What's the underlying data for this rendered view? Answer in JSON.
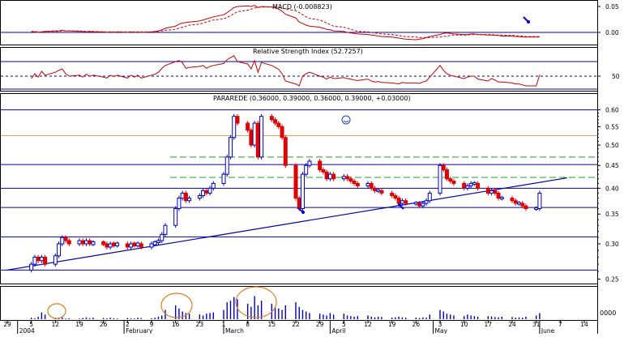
{
  "colors": {
    "background": "#ffffff",
    "panel_border": "#000000",
    "hline_blue": "#0000b0",
    "hline_orange": "#e0a060",
    "hline_green": "#20a020",
    "trend": "#0000b0",
    "candle_up": "#0000c8",
    "candle_down": "#e00000",
    "indicator": "#cc0000",
    "volume": "#0000c8",
    "annotation_circle": "#e08020",
    "arrow": "#0000cc"
  },
  "panels": {
    "macd_title": "MACD (-0.008823)",
    "rsi_title": "Relative Strength Index (52.7257)",
    "price_title": "PARAREDE (0.36000, 0.39000, 0.36000, 0.39000, +0.03000)",
    "volume_unit": "0000"
  },
  "axis_labels": {
    "macd_ticks": [
      "0.05",
      "0.00"
    ],
    "rsi_ticks": [
      "50"
    ],
    "price_ticks": [
      "0.60",
      "0.55",
      "0.50",
      "0.45",
      "0.40",
      "0.35",
      "0.30",
      "0.25"
    ],
    "x_days": [
      "29",
      "5",
      "12",
      "19",
      "26",
      "2",
      "9",
      "16",
      "23",
      "1",
      "8",
      "15",
      "22",
      "29",
      "5",
      "12",
      "19",
      "26",
      "3",
      "10",
      "17",
      "24",
      "31",
      "7",
      "14"
    ],
    "x_months": [
      "2004",
      "February",
      "March",
      "April",
      "May",
      "June"
    ]
  },
  "chart_data": [
    {
      "type": "candlestick",
      "title": "PARAREDE (0.36000, 0.39000, 0.36000, 0.39000, +0.03000)",
      "x_start": "2003-12-29",
      "x_end": "2004-06-14",
      "ylim": [
        0.24,
        0.62
      ],
      "yscale": "log",
      "yticks": [
        0.6,
        0.55,
        0.5,
        0.45,
        0.4,
        0.35,
        0.3,
        0.25
      ],
      "grid": false,
      "horizontal_lines": [
        {
          "value": 0.6,
          "color": "blue",
          "style": "solid"
        },
        {
          "value": 0.525,
          "color": "orange",
          "style": "solid"
        },
        {
          "value": 0.47,
          "color": "green",
          "style": "dashed"
        },
        {
          "value": 0.452,
          "color": "blue",
          "style": "solid"
        },
        {
          "value": 0.423,
          "color": "green",
          "style": "dashed"
        },
        {
          "value": 0.4,
          "color": "blue",
          "style": "solid"
        },
        {
          "value": 0.362,
          "color": "blue",
          "style": "solid"
        },
        {
          "value": 0.311,
          "color": "blue",
          "style": "solid"
        },
        {
          "value": 0.262,
          "color": "blue",
          "style": "solid"
        }
      ],
      "trendline": {
        "from": [
          "2003-12-29",
          0.262
        ],
        "to": [
          "2004-06-09",
          0.422
        ]
      },
      "dates": [
        "2004-01-05",
        "2004-01-06",
        "2004-01-07",
        "2004-01-08",
        "2004-01-09",
        "2004-01-12",
        "2004-01-13",
        "2004-01-14",
        "2004-01-15",
        "2004-01-16",
        "2004-01-19",
        "2004-01-20",
        "2004-01-21",
        "2004-01-22",
        "2004-01-23",
        "2004-01-26",
        "2004-01-27",
        "2004-01-28",
        "2004-01-29",
        "2004-01-30",
        "2004-02-02",
        "2004-02-03",
        "2004-02-04",
        "2004-02-05",
        "2004-02-06",
        "2004-02-09",
        "2004-02-10",
        "2004-02-11",
        "2004-02-12",
        "2004-02-13",
        "2004-02-16",
        "2004-02-17",
        "2004-02-18",
        "2004-02-19",
        "2004-02-20",
        "2004-02-23",
        "2004-02-24",
        "2004-02-25",
        "2004-02-26",
        "2004-02-27",
        "2004-03-01",
        "2004-03-02",
        "2004-03-03",
        "2004-03-04",
        "2004-03-05",
        "2004-03-08",
        "2004-03-09",
        "2004-03-10",
        "2004-03-11",
        "2004-03-12",
        "2004-03-15",
        "2004-03-16",
        "2004-03-17",
        "2004-03-18",
        "2004-03-19",
        "2004-03-22",
        "2004-03-23",
        "2004-03-24",
        "2004-03-25",
        "2004-03-26",
        "2004-03-29",
        "2004-03-30",
        "2004-03-31",
        "2004-04-01",
        "2004-04-02",
        "2004-04-05",
        "2004-04-06",
        "2004-04-07",
        "2004-04-08",
        "2004-04-09",
        "2004-04-12",
        "2004-04-13",
        "2004-04-14",
        "2004-04-15",
        "2004-04-16",
        "2004-04-19",
        "2004-04-20",
        "2004-04-21",
        "2004-04-22",
        "2004-04-23",
        "2004-04-26",
        "2004-04-27",
        "2004-04-28",
        "2004-04-29",
        "2004-04-30",
        "2004-05-03",
        "2004-05-04",
        "2004-05-05",
        "2004-05-06",
        "2004-05-07",
        "2004-05-10",
        "2004-05-11",
        "2004-05-12",
        "2004-05-13",
        "2004-05-14",
        "2004-05-17",
        "2004-05-18",
        "2004-05-19",
        "2004-05-20",
        "2004-05-21",
        "2004-05-24",
        "2004-05-25",
        "2004-05-26",
        "2004-05-27",
        "2004-05-28",
        "2004-05-31",
        "2004-06-01"
      ],
      "close": [
        0.27,
        0.28,
        0.275,
        0.28,
        0.27,
        0.282,
        0.3,
        0.31,
        0.305,
        0.3,
        0.305,
        0.3,
        0.305,
        0.3,
        0.302,
        0.3,
        0.295,
        0.3,
        0.298,
        0.3,
        0.295,
        0.3,
        0.298,
        0.3,
        0.295,
        0.3,
        0.302,
        0.305,
        0.315,
        0.33,
        0.36,
        0.38,
        0.39,
        0.375,
        0.38,
        0.385,
        0.395,
        0.39,
        0.4,
        0.41,
        0.43,
        0.47,
        0.52,
        0.58,
        0.56,
        0.54,
        0.5,
        0.56,
        0.47,
        0.58,
        0.57,
        0.56,
        0.55,
        0.52,
        0.45,
        0.38,
        0.36,
        0.43,
        0.45,
        0.46,
        0.44,
        0.435,
        0.42,
        0.43,
        0.42,
        0.425,
        0.42,
        0.415,
        0.41,
        0.405,
        0.41,
        0.4,
        0.395,
        0.395,
        0.39,
        0.385,
        0.38,
        0.37,
        0.375,
        0.37,
        0.37,
        0.365,
        0.37,
        0.375,
        0.39,
        0.45,
        0.44,
        0.42,
        0.415,
        0.41,
        0.4,
        0.405,
        0.41,
        0.41,
        0.4,
        0.39,
        0.395,
        0.39,
        0.38,
        0.38,
        0.375,
        0.37,
        0.37,
        0.365,
        0.36,
        0.36,
        0.39
      ],
      "volume_percent_of_axis": [
        5,
        3,
        8,
        22,
        15,
        4,
        3,
        6,
        2,
        3,
        2,
        4,
        6,
        3,
        5,
        4,
        3,
        5,
        3,
        2,
        4,
        3,
        2,
        5,
        4,
        3,
        5,
        8,
        12,
        30,
        45,
        35,
        25,
        20,
        18,
        15,
        12,
        18,
        20,
        22,
        30,
        55,
        60,
        72,
        65,
        50,
        40,
        75,
        45,
        60,
        50,
        40,
        35,
        30,
        45,
        55,
        40,
        30,
        25,
        20,
        18,
        15,
        12,
        20,
        15,
        18,
        12,
        10,
        8,
        10,
        12,
        8,
        6,
        8,
        7,
        5,
        6,
        8,
        6,
        5,
        5,
        4,
        6,
        5,
        15,
        30,
        25,
        18,
        15,
        12,
        10,
        15,
        12,
        10,
        8,
        10,
        9,
        7,
        6,
        8,
        7,
        5,
        6,
        5,
        8,
        12,
        20
      ]
    },
    {
      "type": "line",
      "title": "MACD (-0.008823)",
      "ylim": [
        -0.02,
        0.065
      ],
      "yticks": [
        0.05,
        0.0
      ],
      "series": [
        {
          "name": "MACD",
          "style": "solid",
          "values": [
            0.001,
            0.001,
            0.0,
            0.001,
            0.002,
            0.003,
            0.003,
            0.004,
            0.003,
            0.003,
            0.002,
            0.002,
            0.001,
            0.002,
            0.001,
            0.001,
            0.0,
            0.001,
            0.0,
            0.001,
            0.0,
            0.001,
            0.0,
            0.001,
            0.0,
            0.001,
            0.002,
            0.003,
            0.005,
            0.008,
            0.012,
            0.016,
            0.018,
            0.019,
            0.02,
            0.022,
            0.024,
            0.026,
            0.028,
            0.03,
            0.034,
            0.038,
            0.043,
            0.048,
            0.05,
            0.051,
            0.05,
            0.052,
            0.048,
            0.05,
            0.049,
            0.047,
            0.045,
            0.041,
            0.035,
            0.028,
            0.02,
            0.017,
            0.014,
            0.012,
            0.01,
            0.008,
            0.006,
            0.005,
            0.003,
            0.002,
            0.0,
            -0.001,
            -0.002,
            -0.003,
            -0.004,
            -0.005,
            -0.006,
            -0.007,
            -0.008,
            -0.009,
            -0.01,
            -0.011,
            -0.012,
            -0.013,
            -0.014,
            -0.013,
            -0.012,
            -0.01,
            -0.008,
            -0.004,
            -0.002,
            -0.001,
            -0.002,
            -0.003,
            -0.004,
            -0.004,
            -0.003,
            -0.003,
            -0.004,
            -0.005,
            -0.005,
            -0.006,
            -0.006,
            -0.007,
            -0.007,
            -0.008,
            -0.008,
            -0.009,
            -0.009,
            -0.009,
            -0.009
          ]
        },
        {
          "name": "Signal",
          "style": "dashed",
          "values": [
            0.002,
            0.002,
            0.001,
            0.001,
            0.002,
            0.002,
            0.002,
            0.003,
            0.003,
            0.003,
            0.003,
            0.002,
            0.002,
            0.002,
            0.002,
            0.001,
            0.001,
            0.001,
            0.001,
            0.001,
            0.001,
            0.001,
            0.001,
            0.001,
            0.001,
            0.001,
            0.001,
            0.002,
            0.003,
            0.004,
            0.006,
            0.008,
            0.01,
            0.012,
            0.014,
            0.016,
            0.018,
            0.02,
            0.022,
            0.024,
            0.026,
            0.029,
            0.032,
            0.036,
            0.04,
            0.043,
            0.045,
            0.047,
            0.048,
            0.049,
            0.049,
            0.049,
            0.048,
            0.047,
            0.045,
            0.042,
            0.038,
            0.034,
            0.03,
            0.027,
            0.024,
            0.021,
            0.018,
            0.015,
            0.012,
            0.01,
            0.008,
            0.006,
            0.004,
            0.002,
            0.001,
            0.0,
            -0.001,
            -0.002,
            -0.003,
            -0.004,
            -0.005,
            -0.006,
            -0.007,
            -0.008,
            -0.009,
            -0.01,
            -0.01,
            -0.01,
            -0.01,
            -0.009,
            -0.008,
            -0.007,
            -0.006,
            -0.005,
            -0.005,
            -0.005,
            -0.004,
            -0.004,
            -0.004,
            -0.004,
            -0.004,
            -0.005,
            -0.005,
            -0.005,
            -0.006,
            -0.006,
            -0.007,
            -0.007,
            -0.008,
            -0.008,
            -0.008
          ]
        }
      ]
    },
    {
      "type": "line",
      "title": "Relative Strength Index (52.7257)",
      "ylim": [
        0,
        100
      ],
      "yticks": [
        50
      ],
      "horizontal_lines": [
        {
          "value": 50,
          "style": "dashed"
        }
      ],
      "series": [
        {
          "name": "RSI",
          "values": [
            45,
            55,
            48,
            60,
            52,
            58,
            62,
            65,
            55,
            50,
            52,
            48,
            54,
            50,
            52,
            48,
            46,
            52,
            49,
            52,
            46,
            52,
            48,
            52,
            46,
            52,
            54,
            58,
            66,
            72,
            80,
            82,
            78,
            66,
            68,
            70,
            72,
            66,
            70,
            72,
            76,
            84,
            88,
            92,
            80,
            75,
            65,
            82,
            58,
            78,
            72,
            68,
            64,
            55,
            40,
            34,
            30,
            50,
            55,
            58,
            50,
            48,
            44,
            48,
            45,
            47,
            45,
            44,
            42,
            41,
            44,
            40,
            38,
            39,
            37,
            36,
            35,
            34,
            37,
            36,
            36,
            35,
            38,
            40,
            48,
            72,
            62,
            55,
            52,
            50,
            45,
            48,
            50,
            50,
            44,
            40,
            45,
            42,
            38,
            38,
            36,
            34,
            34,
            32,
            30,
            30,
            52.7257
          ]
        }
      ]
    }
  ]
}
